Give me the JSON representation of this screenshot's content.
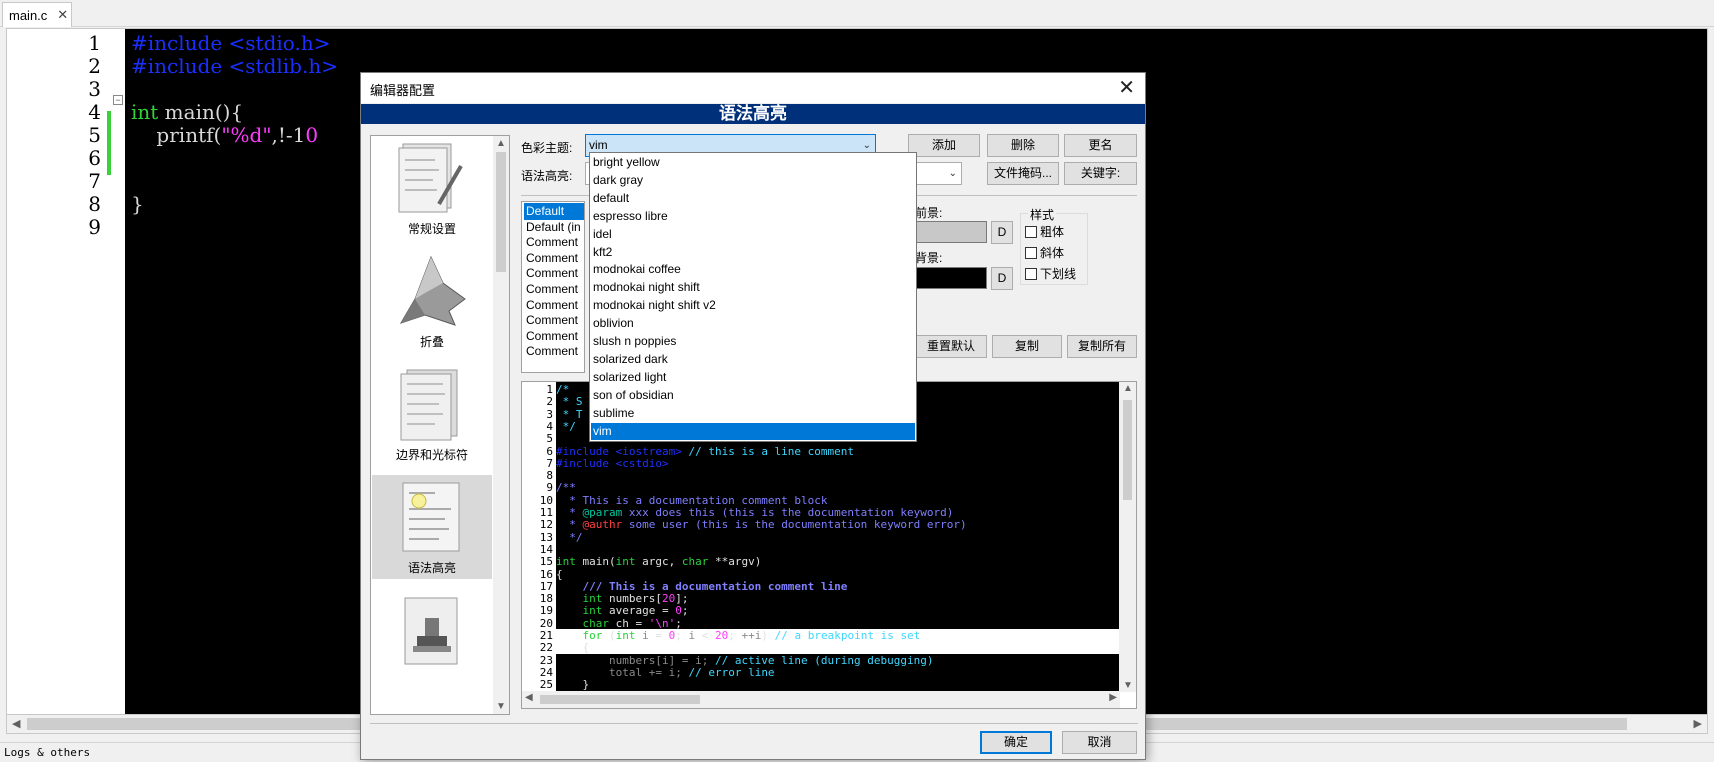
{
  "tab": {
    "name": "main.c",
    "close": "✕"
  },
  "editor": {
    "line_numbers": [
      "1",
      "2",
      "3",
      "4",
      "5",
      "6",
      "7",
      "8",
      "9"
    ],
    "lines": [
      {
        "parts": [
          {
            "c": "pp",
            "t": "#include <stdio.h>"
          }
        ]
      },
      {
        "parts": [
          {
            "c": "pp",
            "t": "#include <stdlib.h>"
          }
        ]
      },
      {
        "parts": []
      },
      {
        "parts": [
          {
            "c": "kw",
            "t": "int"
          },
          {
            "c": "pl",
            "t": " main(){"
          }
        ]
      },
      {
        "parts": [
          {
            "c": "pl",
            "t": "    printf("
          },
          {
            "c": "st",
            "t": "\"%d\""
          },
          {
            "c": "pl",
            "t": ",!-1"
          },
          {
            "c": "st",
            "t": "0"
          }
        ]
      },
      {
        "parts": []
      },
      {
        "parts": []
      },
      {
        "parts": [
          {
            "c": "pl",
            "t": "}"
          }
        ]
      },
      {
        "parts": []
      }
    ]
  },
  "status": "Logs & others",
  "dialog": {
    "title": "编辑器配置",
    "close": "✕",
    "banner": "语法高亮",
    "nav": [
      {
        "label": "常规设置",
        "icon": "general-settings-icon"
      },
      {
        "label": "折叠",
        "icon": "folding-icon"
      },
      {
        "label": "边界和光标符",
        "icon": "margins-caret-icon"
      },
      {
        "label": "语法高亮",
        "icon": "syntax-highlight-icon"
      },
      {
        "label": "",
        "icon": "stamp-icon"
      }
    ],
    "color_theme_label": "色彩主题:",
    "color_theme_value": "vim",
    "syntax_label": "语法高亮:",
    "buttons": {
      "add": "添加",
      "delete": "删除",
      "rename": "更名",
      "file_masks": "文件掩码...",
      "keywords": "关键字:",
      "reset_default": "重置默认",
      "copy": "复制",
      "copy_all": "复制所有",
      "ok": "确定",
      "cancel": "取消",
      "d": "D"
    },
    "theme_options": [
      "bright yellow",
      "dark gray",
      "default",
      "espresso libre",
      "idel",
      "kft2",
      "modnokai coffee",
      "modnokai night shift",
      "modnokai night shift v2",
      "oblivion",
      "slush n poppies",
      "solarized dark",
      "solarized light",
      "son of obsidian",
      "sublime",
      "vim"
    ],
    "styles": [
      "Default",
      "Default (in",
      "Comment",
      "Comment",
      "Comment",
      "Comment",
      "Comment",
      "Comment",
      "Comment",
      "Comment"
    ],
    "foreground_label": "前景:",
    "background_label": "背景:",
    "style_group_label": "样式",
    "bold": "粗体",
    "italic": "斜体",
    "underline": "下划线",
    "colors": {
      "foreground": "#c8c8c8",
      "background": "#000000",
      "selection": "#0078d7",
      "banner": "#00307a"
    }
  },
  "preview": {
    "line_numbers": [
      "1",
      "2",
      "3",
      "4",
      "5",
      "6",
      "7",
      "8",
      "9",
      "10",
      "11",
      "12",
      "13",
      "14",
      "15",
      "16",
      "17",
      "18",
      "19",
      "20",
      "21",
      "22",
      "23",
      "24",
      "25"
    ],
    "lines": [
      {
        "parts": [
          {
            "c": "c-cmt",
            "t": "/*"
          }
        ]
      },
      {
        "parts": [
          {
            "c": "c-cmt",
            "t": " * S"
          }
        ]
      },
      {
        "parts": [
          {
            "c": "c-cmt",
            "t": " * T"
          }
        ]
      },
      {
        "parts": [
          {
            "c": "c-cmt",
            "t": " */"
          }
        ]
      },
      {
        "parts": []
      },
      {
        "parts": [
          {
            "c": "c-pp",
            "t": "#include <iostream>"
          },
          {
            "c": "c-cmt",
            "t": " // this is a line comment"
          }
        ]
      },
      {
        "parts": [
          {
            "c": "c-pp",
            "t": "#include <cstdio>"
          }
        ]
      },
      {
        "parts": []
      },
      {
        "parts": [
          {
            "c": "c-doc",
            "t": "/**"
          }
        ]
      },
      {
        "parts": [
          {
            "c": "c-doc",
            "t": "  * This is a documentation comment block"
          }
        ]
      },
      {
        "parts": [
          {
            "c": "c-doc",
            "t": "  * "
          },
          {
            "c": "c-dkw",
            "t": "@param"
          },
          {
            "c": "c-doc",
            "t": " xxx does this (this is the documentation keyword)"
          }
        ]
      },
      {
        "parts": [
          {
            "c": "c-doc",
            "t": "  * "
          },
          {
            "c": "c-err",
            "t": "@authr"
          },
          {
            "c": "c-doc",
            "t": " some user (this is the documentation keyword error)"
          }
        ]
      },
      {
        "parts": [
          {
            "c": "c-doc",
            "t": "  */"
          }
        ]
      },
      {
        "parts": []
      },
      {
        "parts": [
          {
            "c": "c-kw",
            "t": "int"
          },
          {
            "c": "c-txt",
            "t": " main("
          },
          {
            "c": "c-kw",
            "t": "int"
          },
          {
            "c": "c-txt",
            "t": " argc, "
          },
          {
            "c": "c-kw",
            "t": "char"
          },
          {
            "c": "c-txt",
            "t": " **argv)"
          }
        ]
      },
      {
        "parts": [
          {
            "c": "c-txt",
            "t": "{"
          }
        ]
      },
      {
        "parts": [
          {
            "c": "c-dl",
            "t": "    /// This is a documentation comment line"
          }
        ]
      },
      {
        "parts": [
          {
            "c": "c-kw",
            "t": "    int"
          },
          {
            "c": "c-txt",
            "t": " numbers["
          },
          {
            "c": "c-num",
            "t": "20"
          },
          {
            "c": "c-txt",
            "t": "];"
          }
        ]
      },
      {
        "parts": [
          {
            "c": "c-kw",
            "t": "    int"
          },
          {
            "c": "c-txt",
            "t": " average = "
          },
          {
            "c": "c-num",
            "t": "0"
          },
          {
            "c": "c-txt",
            "t": ";"
          }
        ]
      },
      {
        "parts": [
          {
            "c": "c-kw",
            "t": "    char"
          },
          {
            "c": "c-txt",
            "t": " ch = "
          },
          {
            "c": "c-str",
            "t": "'\\n'"
          },
          {
            "c": "c-txt",
            "t": ";"
          }
        ]
      },
      {
        "hl": true,
        "parts": [
          {
            "c": "c-kw",
            "t": "    for"
          },
          {
            "c": "c-txt",
            "t": " ("
          },
          {
            "c": "c-kw",
            "t": "int"
          },
          {
            "c": "c-gray",
            "t": " i "
          },
          {
            "c": "c-txt",
            "t": "= "
          },
          {
            "c": "c-num",
            "t": "0"
          },
          {
            "c": "c-txt",
            "t": "; "
          },
          {
            "c": "c-gray",
            "t": "i "
          },
          {
            "c": "c-txt",
            "t": "< "
          },
          {
            "c": "c-num",
            "t": "20"
          },
          {
            "c": "c-txt",
            "t": "; "
          },
          {
            "c": "c-gray",
            "t": "++i"
          },
          {
            "c": "c-txt",
            "t": ") "
          },
          {
            "c": "c-cmt",
            "t": "// a breakpoint is set"
          }
        ]
      },
      {
        "hl": true,
        "parts": [
          {
            "c": "c-txt",
            "t": "    {"
          }
        ]
      },
      {
        "parts": [
          {
            "c": "c-gray",
            "t": "        numbers[i] = i;"
          },
          {
            "c": "c-cmt",
            "t": " // active line (during debugging)"
          }
        ]
      },
      {
        "parts": [
          {
            "c": "c-gray",
            "t": "        total += i;"
          },
          {
            "c": "c-cmt",
            "t": " // error line"
          }
        ]
      },
      {
        "parts": [
          {
            "c": "c-txt",
            "t": "    }"
          }
        ]
      }
    ]
  }
}
